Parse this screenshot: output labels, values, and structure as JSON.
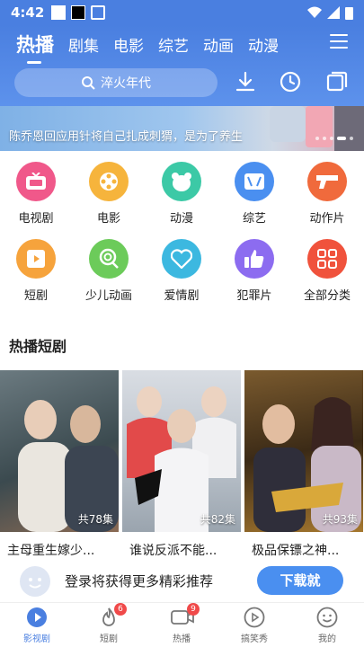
{
  "status_bar": {
    "time": "4:42"
  },
  "header": {
    "tabs": [
      {
        "label": "热播",
        "active": true
      },
      {
        "label": "剧集"
      },
      {
        "label": "电影"
      },
      {
        "label": "综艺"
      },
      {
        "label": "动画"
      },
      {
        "label": "动漫"
      }
    ],
    "search_placeholder": "淬火年代"
  },
  "banner": {
    "caption": "陈乔恩回应用针将自己扎成刺猬，是为了养生"
  },
  "categories": [
    {
      "label": "电视剧",
      "color": "#f0588a",
      "icon": "tv-icon"
    },
    {
      "label": "电影",
      "color": "#f6b43c",
      "icon": "film-reel-icon"
    },
    {
      "label": "动漫",
      "color": "#3cc9a6",
      "icon": "bear-icon"
    },
    {
      "label": "综艺",
      "color": "#4a8ff0",
      "icon": "variety-icon"
    },
    {
      "label": "动作片",
      "color": "#f06a3c",
      "icon": "gun-icon"
    },
    {
      "label": "短剧",
      "color": "#f6a33c",
      "icon": "play-icon"
    },
    {
      "label": "少儿动画",
      "color": "#6ccb5a",
      "icon": "lollipop-icon"
    },
    {
      "label": "爱情剧",
      "color": "#3cb8e0",
      "icon": "heart-icon"
    },
    {
      "label": "犯罪片",
      "color": "#8c6cf0",
      "icon": "thumbs-up-icon"
    },
    {
      "label": "全部分类",
      "color": "#f0523c",
      "icon": "grid-icon"
    }
  ],
  "section": {
    "title": "热播短剧"
  },
  "posters": [
    {
      "title": "主母重生嫁少...",
      "episodes": "共78集"
    },
    {
      "title": "谁说反派不能...",
      "episodes": "共82集"
    },
    {
      "title": "极品保镖之神...",
      "episodes": "共93集"
    }
  ],
  "login": {
    "text": "登录将获得更多精彩推荐",
    "button": "下载就"
  },
  "bottom_nav": [
    {
      "label": "影视剧",
      "icon": "play-circle-icon",
      "active": true
    },
    {
      "label": "短剧",
      "icon": "flame-icon",
      "badge": "6"
    },
    {
      "label": "热播",
      "icon": "video-icon",
      "badge": "9"
    },
    {
      "label": "搞笑秀",
      "icon": "play-outline-icon"
    },
    {
      "label": "我的",
      "icon": "smile-icon"
    }
  ]
}
